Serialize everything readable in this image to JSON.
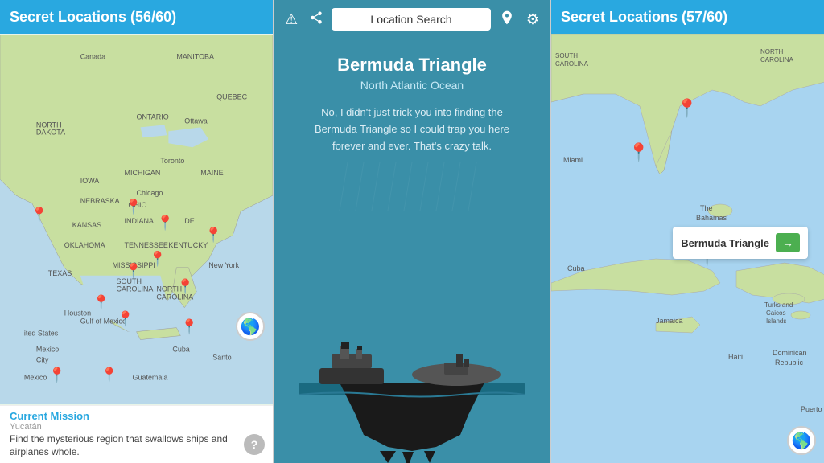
{
  "left": {
    "header": "Secret Locations (56/60)",
    "mission": {
      "title": "Current Mission",
      "subtitle": "Yucatán",
      "text": "Find the mysterious region that swallows ships and airplanes whole.",
      "help_icon": "?"
    },
    "globe_icon": "🌎"
  },
  "middle": {
    "toolbar": {
      "warning_icon": "⚠",
      "share_icon": "⎘",
      "search_placeholder": "Location Search",
      "pin_icon": "📍",
      "settings_icon": "⚙"
    },
    "location": {
      "name": "Bermuda Triangle",
      "subtitle": "North Atlantic Ocean",
      "description": "No, I didn't just trick you into finding the Bermuda Triangle so I could trap you here forever and ever. That's crazy talk."
    }
  },
  "right": {
    "header": "Secret Locations (57/60)",
    "tooltip": {
      "label": "Bermuda Triangle",
      "arrow": "→"
    },
    "globe_icon": "🌎"
  }
}
